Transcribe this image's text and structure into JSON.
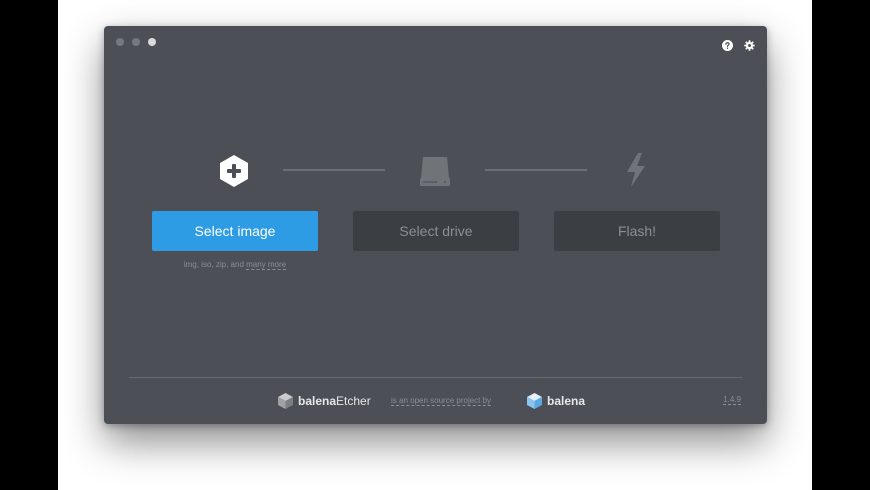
{
  "app": {
    "steps": [
      {
        "label": "Select image",
        "icon": "plus-hexagon-icon",
        "state": "active"
      },
      {
        "label": "Select drive",
        "icon": "drive-icon",
        "state": "disabled"
      },
      {
        "label": "Flash!",
        "icon": "lightning-icon",
        "state": "disabled"
      }
    ],
    "formats_text": "img, iso, zip, and ",
    "formats_more": "many more",
    "footer": {
      "etcher_brand_bold": "balena",
      "etcher_brand_rest": "Etcher",
      "open_source_text": "is an open source project by",
      "balena_brand": "balena",
      "version": "1.4.9"
    },
    "top_icons": [
      "help-icon",
      "gear-icon"
    ]
  },
  "colors": {
    "window_bg": "#4c4f55",
    "accent": "#2d9ce5",
    "disabled_button": "#3b3e43"
  }
}
